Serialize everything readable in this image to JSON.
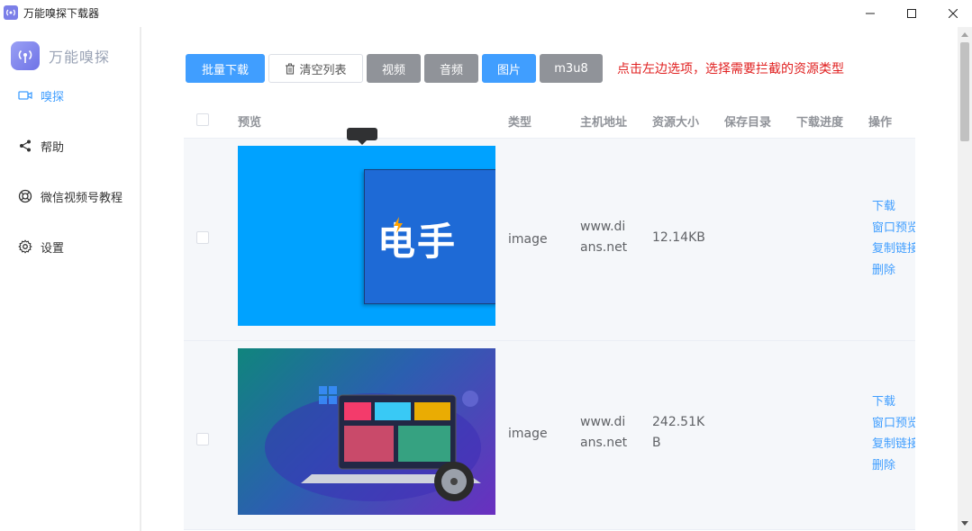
{
  "window": {
    "title": "万能嗅探下载器"
  },
  "sidebar": {
    "brand": "万能嗅探",
    "items": [
      {
        "label": "嗅探",
        "icon": "video-icon",
        "active": true
      },
      {
        "label": "帮助",
        "icon": "share-icon"
      },
      {
        "label": "微信视频号教程",
        "icon": "lifebuoy-icon"
      },
      {
        "label": "设置",
        "icon": "gear-icon"
      }
    ]
  },
  "toolbar": {
    "batch_download": "批量下载",
    "clear_list": "清空列表",
    "video": "视频",
    "audio": "音频",
    "image": "图片",
    "m3u8": "m3u8",
    "hint": "点击左边选项，选择需要拦截的资源类型"
  },
  "table": {
    "headers": [
      "预览",
      "类型",
      "主机地址",
      "资源大小",
      "保存目录",
      "下载进度",
      "操作"
    ],
    "rows": [
      {
        "preview_text": "电手",
        "type": "image",
        "host_line1": "www.di",
        "host_line2": "ans.net",
        "size_line1": "12.14KB",
        "size_line2": "",
        "save_dir": "",
        "progress": ""
      },
      {
        "preview_text": "",
        "type": "image",
        "host_line1": "www.di",
        "host_line2": "ans.net",
        "size_line1": "242.51K",
        "size_line2": "B",
        "save_dir": "",
        "progress": ""
      }
    ],
    "ops": {
      "download": "下载",
      "preview": "窗口预览",
      "copy_link": "复制链接",
      "delete": "删除"
    }
  },
  "colors": {
    "primary": "#409eff",
    "gray_button": "#909399",
    "hint": "#e02020"
  }
}
